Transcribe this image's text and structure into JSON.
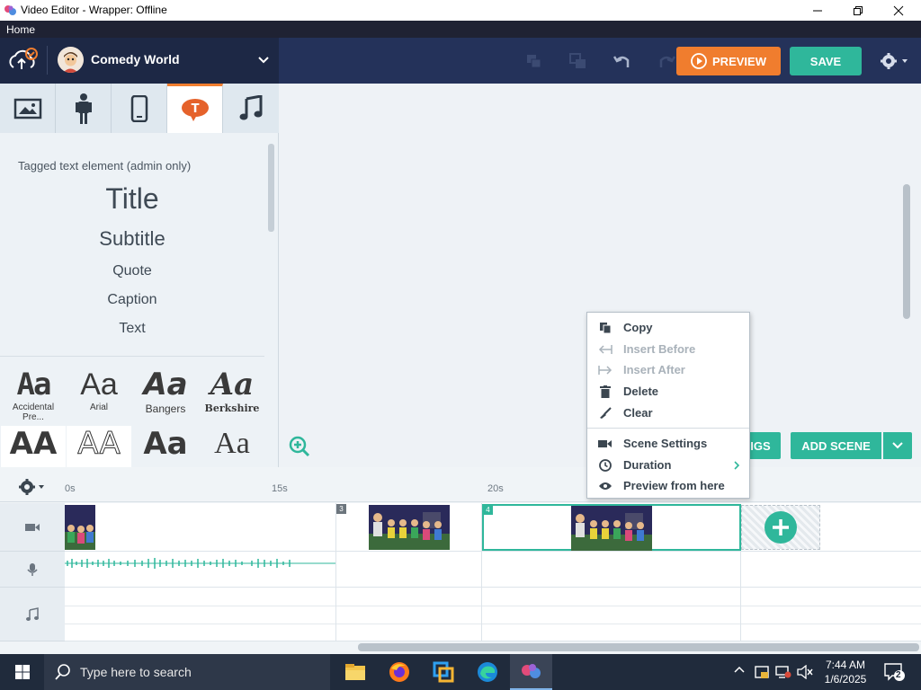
{
  "window": {
    "title": "Video Editor - Wrapper: Offline"
  },
  "menu": {
    "home": "Home"
  },
  "topbar": {
    "movie_title": "Comedy World",
    "preview_label": "PREVIEW",
    "save_label": "SAVE"
  },
  "library": {
    "tabs": [
      {
        "name": "backgrounds",
        "icon": "image-icon"
      },
      {
        "name": "characters",
        "icon": "character-icon"
      },
      {
        "name": "props",
        "icon": "phone-icon"
      },
      {
        "name": "text",
        "icon": "text-bubble-icon",
        "active": true
      },
      {
        "name": "audio",
        "icon": "music-note-icon"
      }
    ],
    "text_header": "Tagged text element (admin only)",
    "text_items": [
      "Title",
      "Subtitle",
      "Quote",
      "Caption",
      "Text"
    ],
    "fonts": [
      {
        "sample": "Aa",
        "name": "Accidental Pre..."
      },
      {
        "sample": "Aa",
        "name": "Arial"
      },
      {
        "sample": "Aa",
        "name": "Bangers"
      },
      {
        "sample": "Aa",
        "name": "Berkshire"
      },
      {
        "sample": "AA",
        "name": ""
      },
      {
        "sample": "AA",
        "name": ""
      },
      {
        "sample": "Aa",
        "name": ""
      },
      {
        "sample": "Aa",
        "name": ""
      }
    ]
  },
  "stage": {
    "settings_label": "IGS",
    "add_scene_label": "ADD SCENE"
  },
  "timeline": {
    "ticks": [
      "0s",
      "15s",
      "20s"
    ],
    "scenes": [
      "3",
      "4"
    ]
  },
  "context_menu": {
    "items": [
      {
        "label": "Copy",
        "icon": "copy-icon",
        "disabled": false
      },
      {
        "label": "Insert Before",
        "icon": "insert-before-icon",
        "disabled": true
      },
      {
        "label": "Insert After",
        "icon": "insert-after-icon",
        "disabled": true
      },
      {
        "label": "Delete",
        "icon": "trash-icon",
        "disabled": false
      },
      {
        "label": "Clear",
        "icon": "brush-icon",
        "disabled": false
      },
      {
        "label": "Scene Settings",
        "icon": "camera-icon",
        "disabled": false
      },
      {
        "label": "Duration",
        "icon": "clock-icon",
        "disabled": false
      },
      {
        "label": "Preview from here",
        "icon": "eye-icon",
        "disabled": false
      }
    ]
  },
  "taskbar": {
    "search_placeholder": "Type here to search",
    "time": "7:44 AM",
    "date": "1/6/2025",
    "notifications": "2"
  },
  "colors": {
    "accent_orange": "#f07d2e",
    "accent_teal": "#2fb79b",
    "topbar": "#24325a"
  }
}
